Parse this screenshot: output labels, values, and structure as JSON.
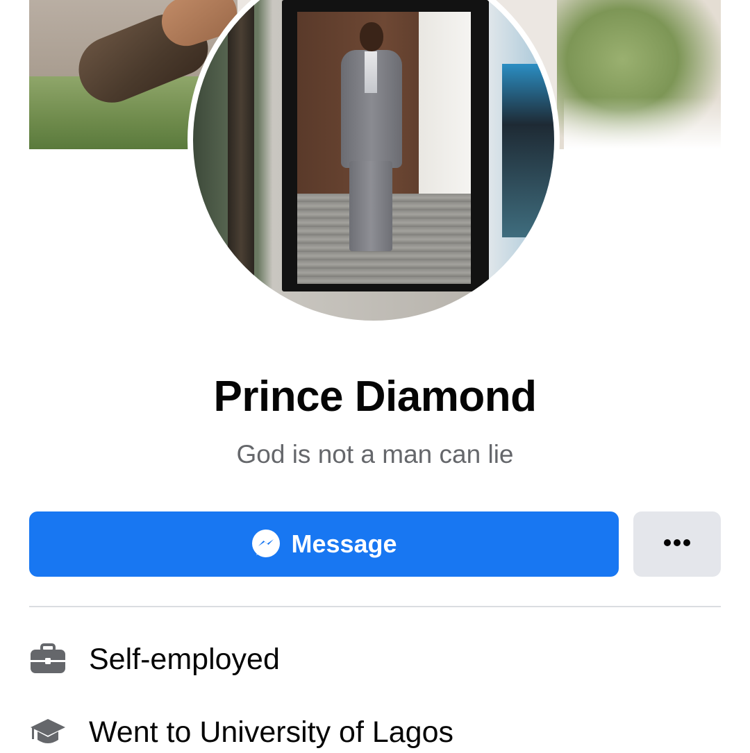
{
  "profile": {
    "name": "Prince Diamond",
    "bio": "God is not a man can lie"
  },
  "actions": {
    "message_label": "Message",
    "message_icon": "messenger-icon",
    "more_icon": "more-horizontal-icon"
  },
  "intro": {
    "items": [
      {
        "icon": "briefcase-icon",
        "text": "Self-employed"
      },
      {
        "icon": "graduation-cap-icon",
        "text": "Went to University of Lagos"
      }
    ]
  },
  "colors": {
    "accent": "#1877f2",
    "secondary_button": "#e4e6eb",
    "subtext": "#65676b",
    "text": "#050505"
  }
}
